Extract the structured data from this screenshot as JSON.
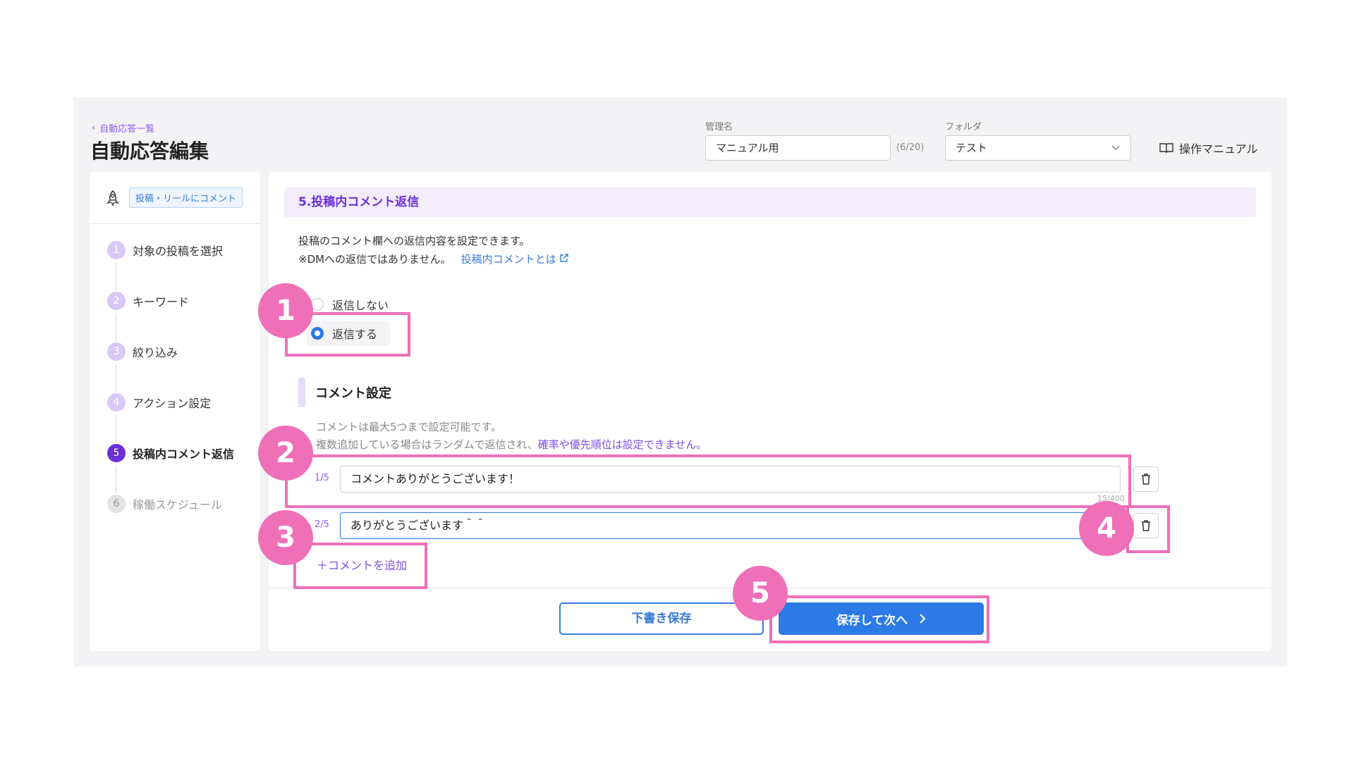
{
  "header": {
    "breadcrumb": "自動応答一覧",
    "title": "自動応答編集",
    "name_label": "管理名",
    "name_value": "マニュアル用",
    "name_counter": "(6/20)",
    "folder_label": "フォルダ",
    "folder_value": "テスト",
    "manual_link": "操作マニュアル"
  },
  "sidebar": {
    "trigger_badge": "投稿・リールにコメント",
    "steps": [
      {
        "num": "1",
        "label": "対象の投稿を選択"
      },
      {
        "num": "2",
        "label": "キーワード"
      },
      {
        "num": "3",
        "label": "絞り込み"
      },
      {
        "num": "4",
        "label": "アクション設定"
      },
      {
        "num": "5",
        "label": "投稿内コメント返信"
      },
      {
        "num": "6",
        "label": "稼働スケジュール"
      }
    ]
  },
  "main": {
    "section_title": "5.投稿内コメント返信",
    "desc_line1": "投稿のコメント欄への返信内容を設定できます。",
    "desc_line2": "※DMへの返信ではありません。",
    "desc_link": "投稿内コメントとは",
    "radio_no": "返信しない",
    "radio_yes": "返信する",
    "comment_heading": "コメント設定",
    "note_line1": "コメントは最大5つまで設定可能です。",
    "note_line2_prefix": "複数追加している場合はランダムで返信され、",
    "note_line2_emph": "確率や優先順位は設定できません。",
    "comments": [
      {
        "index": "1/5",
        "text": "コメントありがとうございます！",
        "count": "15/400"
      },
      {
        "index": "2/5",
        "text": "ありがとうございます＾＾"
      }
    ],
    "add_comment": "＋コメントを追加",
    "draft_button": "下書き保存",
    "next_button": "保存して次へ"
  },
  "annotations": [
    "1",
    "2",
    "3",
    "4",
    "5"
  ]
}
